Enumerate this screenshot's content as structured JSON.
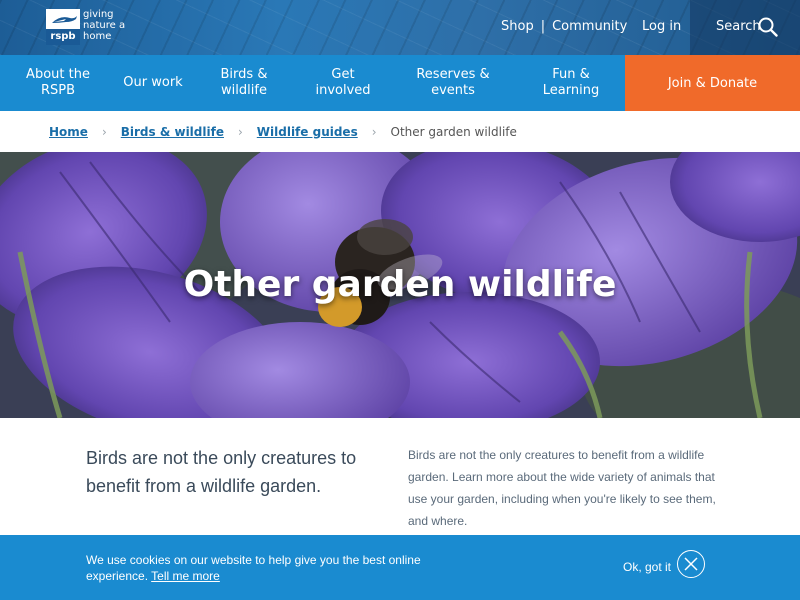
{
  "header": {
    "logo_text": "rspb",
    "logo_tagline": "giving nature a home",
    "shop": "Shop",
    "separator": "|",
    "community": "Community",
    "login": "Log in",
    "search": "Search"
  },
  "nav": {
    "items": [
      {
        "label": "About the RSPB"
      },
      {
        "label": "Our work"
      },
      {
        "label": "Birds & wildlife"
      },
      {
        "label": "Get involved"
      },
      {
        "label": "Reserves & events"
      },
      {
        "label": "Fun & Learning"
      }
    ],
    "join": "Join & Donate"
  },
  "breadcrumb": {
    "items": [
      "Home",
      "Birds & wildlife",
      "Wildlife guides"
    ],
    "current": "Other garden wildlife"
  },
  "hero": {
    "title": "Other garden wildlife"
  },
  "intro": {
    "lead": "Birds are not the only creatures to benefit from a wildlife garden.",
    "body": "Birds are not the only creatures to benefit from a wildlife garden. Learn more about the wide variety of animals that use your garden, including when you're likely to see them, and where."
  },
  "cookie": {
    "text": "We use cookies on our website to help give you the best online experience.",
    "link": "Tell me more",
    "ok": "Ok, got it"
  },
  "colors": {
    "nav_blue": "#1a8bd0",
    "join_orange": "#f06a2a",
    "link_blue": "#1a6ea8"
  },
  "icons": [
    "search-icon",
    "chevron-right-icon",
    "close-icon",
    "rspb-logo"
  ]
}
